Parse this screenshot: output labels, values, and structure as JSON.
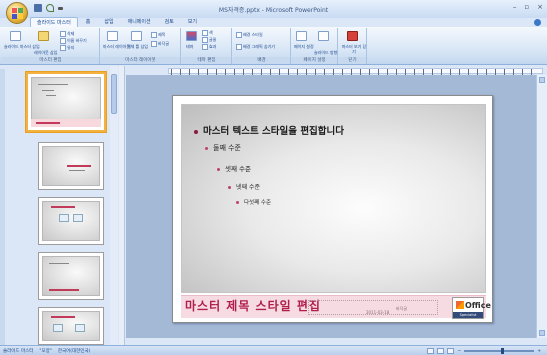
{
  "window": {
    "title": "MS자격증.pptx - Microsoft PowerPoint",
    "controls": [
      "–",
      "▫",
      "×"
    ]
  },
  "ribbon": {
    "tabs": [
      "슬라이드 마스터",
      "홈",
      "삽입",
      "애니메이션",
      "검토",
      "보기"
    ],
    "active_tab": 0,
    "groups": [
      {
        "name": "마스터 편집",
        "buttons": [
          "슬라이드 마스터 삽입",
          "레이아웃 삽입",
          "삭제",
          "이름 바꾸기",
          "유지"
        ]
      },
      {
        "name": "마스터 레이아웃",
        "buttons": [
          "마스터 레이아웃",
          "개체 틀 삽입",
          "제목",
          "바닥글"
        ]
      },
      {
        "name": "테마 편집",
        "buttons": [
          "테마",
          "색",
          "글꼴",
          "효과"
        ]
      },
      {
        "name": "배경",
        "buttons": [
          "배경 스타일",
          "배경 그래픽 숨기기"
        ]
      },
      {
        "name": "페이지 설정",
        "buttons": [
          "페이지 설정",
          "슬라이드 방향"
        ]
      },
      {
        "name": "닫기",
        "buttons": [
          "마스터 보기 닫기"
        ]
      }
    ]
  },
  "slide": {
    "bullets": [
      "마스터 텍스트 스타일을 편집합니다",
      "둘째 수준",
      "셋째 수준",
      "넷째 수준",
      "다섯째 수준"
    ],
    "title": "마스터 제목 스타일 편집",
    "date": "2011-03-18",
    "footer": "바닥글",
    "logo": {
      "word": "Office",
      "sub": "Specialist"
    }
  },
  "statusbar": {
    "view": "슬라이드 마스터",
    "theme": "\"모양\"",
    "language": "한국어(대한민국)",
    "zoom": 0.55
  },
  "colors": {
    "accent": "#b01e4a",
    "ribbon": "#d5e4f5",
    "selected_thumb": "#f3b140"
  }
}
